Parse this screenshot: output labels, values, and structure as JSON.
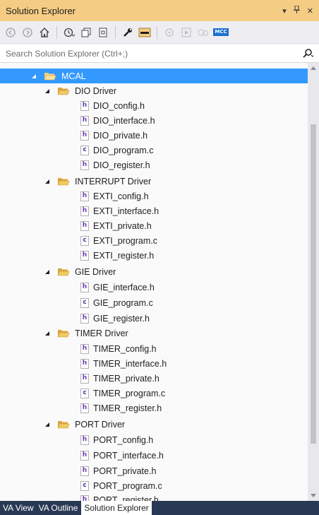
{
  "window": {
    "title": "Solution Explorer",
    "controls": [
      "▾",
      "ᵻ",
      "✕"
    ]
  },
  "toolbar": {
    "icons": [
      "back-icon",
      "forward-icon",
      "home-icon",
      "history-icon",
      "sync-icon",
      "collapse-all-icon",
      "properties-icon",
      "wrench-icon",
      "pin-icon",
      "git-icon",
      "preview-icon",
      "compare-icon",
      "mcc-icon"
    ],
    "mcc_label": "MCC"
  },
  "search": {
    "placeholder": "Search Solution Explorer (Ctrl+;)"
  },
  "tree": {
    "root": {
      "label": "MCAL",
      "expanded": true,
      "selected": true
    },
    "folders": [
      {
        "label": "DIO Driver",
        "files": [
          {
            "name": "DIO_config.h",
            "type": "h"
          },
          {
            "name": "DIO_interface.h",
            "type": "h"
          },
          {
            "name": "DIO_private.h",
            "type": "h"
          },
          {
            "name": "DIO_program.c",
            "type": "c"
          },
          {
            "name": "DIO_register.h",
            "type": "h"
          }
        ]
      },
      {
        "label": "INTERRUPT Driver",
        "files": [
          {
            "name": "EXTI_config.h",
            "type": "h"
          },
          {
            "name": "EXTI_interface.h",
            "type": "h"
          },
          {
            "name": "EXTI_private.h",
            "type": "h"
          },
          {
            "name": "EXTI_program.c",
            "type": "c"
          },
          {
            "name": "EXTI_register.h",
            "type": "h"
          }
        ]
      },
      {
        "label": "GIE Driver",
        "files": [
          {
            "name": "GIE_interface.h",
            "type": "h"
          },
          {
            "name": "GIE_program.c",
            "type": "c"
          },
          {
            "name": "GIE_register.h",
            "type": "h"
          }
        ]
      },
      {
        "label": "TIMER Driver",
        "files": [
          {
            "name": "TIMER_config.h",
            "type": "h"
          },
          {
            "name": "TIMER_interface.h",
            "type": "h"
          },
          {
            "name": "TIMER_private.h",
            "type": "h"
          },
          {
            "name": "TIMER_program.c",
            "type": "c"
          },
          {
            "name": "TIMER_register.h",
            "type": "h"
          }
        ]
      },
      {
        "label": "PORT Driver",
        "files": [
          {
            "name": "PORT_config.h",
            "type": "h"
          },
          {
            "name": "PORT_interface.h",
            "type": "h"
          },
          {
            "name": "PORT_private.h",
            "type": "h"
          },
          {
            "name": "PORT_program.c",
            "type": "c"
          },
          {
            "name": "PORT_register.h",
            "type": "h"
          }
        ]
      }
    ]
  },
  "bottom_tabs": [
    {
      "label": "VA View",
      "active": false
    },
    {
      "label": "VA Outline",
      "active": false
    },
    {
      "label": "Solution Explorer",
      "active": true
    }
  ],
  "colors": {
    "title_bar": "#f5cc84",
    "selection": "#3399ff",
    "folder": "#e8b74a",
    "tab_strip": "#293955"
  }
}
